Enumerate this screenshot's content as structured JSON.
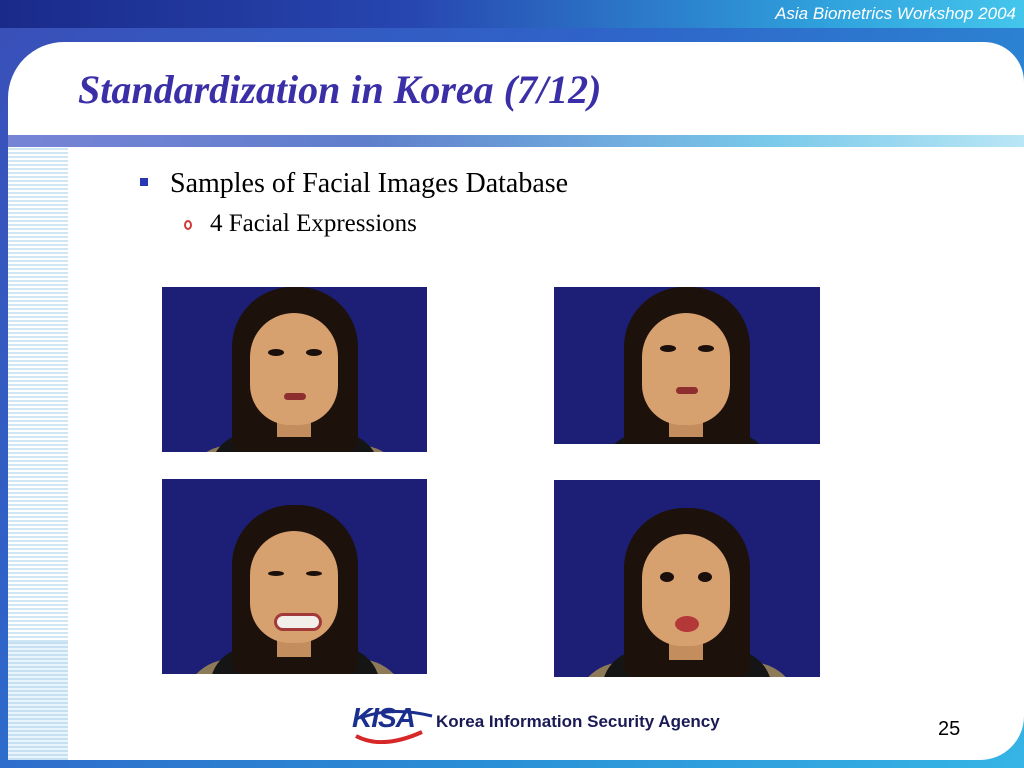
{
  "header": {
    "workshop": "Asia Biometrics Workshop 2004"
  },
  "slide": {
    "title": "Standardization in Korea (7/12)",
    "bullet1": "Samples of Facial Images Database",
    "bullet2": "4 Facial Expressions",
    "page_number": "25"
  },
  "photos": [
    {
      "expression": "neutral"
    },
    {
      "expression": "neutral"
    },
    {
      "expression": "smile"
    },
    {
      "expression": "surprise"
    }
  ],
  "footer": {
    "logo": "KISA",
    "agency": "Korea Information Security Agency",
    "colors": {
      "logo_blue": "#1b2f8f",
      "logo_red": "#d62828"
    }
  },
  "colors": {
    "title": "#3a2fa6",
    "bullet_square": "#2a37b5",
    "photo_bg": "#1c1f75"
  }
}
